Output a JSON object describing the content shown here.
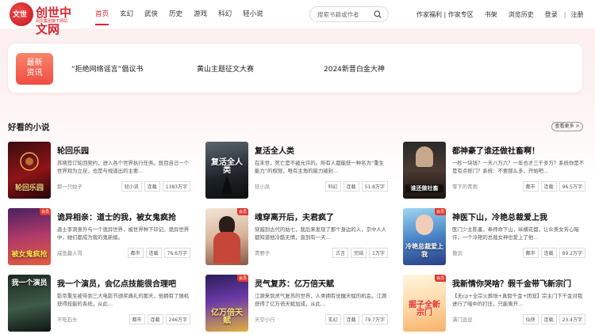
{
  "logo": {
    "badge": "文世",
    "name": "创世中文网",
    "sub": "阅文集团旗下网站"
  },
  "nav": [
    "首页",
    "玄幻",
    "武侠",
    "历史",
    "游戏",
    "科幻",
    "轻小说"
  ],
  "search": {
    "placeholder": "搜索书籍或作者"
  },
  "toplinks": {
    "author": "作家福利 | 作家专区",
    "shelf": "书架",
    "history": "浏览历史",
    "login": "登录",
    "sep": "|",
    "register": "注册"
  },
  "notice": {
    "badge_line1": "最新",
    "badge_line2": "资讯",
    "items": [
      "“拒绝网络谣言”倡议书",
      "黄山主题征文大赛",
      "2024新晋白金大神"
    ]
  },
  "section": {
    "title": "好看的小说",
    "more": "查看更多 >"
  },
  "books": [
    {
      "title": "轮回乐园",
      "desc": "苏晓签订轮回契约，进入各个世界执行任务。既目自己一个世界观为立足，也是与规道出的主要...",
      "author": "那一只蚊子",
      "tags": [
        "轻小说",
        "连载",
        "1383万字"
      ],
      "cover_text": "轮回乐园",
      "badge": ""
    },
    {
      "title": "复活全人类",
      "desc": "在末世，死亡是不被允许的。所有人都能获一种名为“重生能力”的权限，唯有主角的能力被封...",
      "author": "狂小风",
      "tags": [
        "科幻",
        "连载",
        "51.8万字"
      ],
      "cover_text": "复活全人类",
      "badge": ""
    },
    {
      "title": "都神豪了谁还做社畜啊！",
      "desc": "一秒一块钱？一天八万六？一年也才三千多万？系统你是不是有点抠门？系统：不要那么多，开始吧...",
      "author": "零下的青雨",
      "tags": [
        "都市",
        "连载",
        "96.5万字"
      ],
      "cover_text": "谁还做社畜",
      "badge": ""
    },
    {
      "title": "诡异相亲：道士的我，被女鬼疯抢",
      "desc": "道士李洞意外与一个诡异世界，被世界种下印记。诡异世界中，她们都成为我的鬼新娘。",
      "author": "咸鱼趣人哥",
      "tags": [
        "都市",
        "连载",
        "76.6万字"
      ],
      "cover_text": "被女鬼疯抢",
      "badge": "会员"
    },
    {
      "title": "魂穿离开后，夫君疯了",
      "desc": "穿越到古代的姑七，我后来发现了那个身边的人，京中人人都知道他冷酷无情，直到有一天...",
      "author": "青野子",
      "tags": [
        "古言",
        "完结",
        "1万字"
      ],
      "cover_text": "",
      "badge": "会员"
    },
    {
      "title": "神医下山，冷艳总裁爱上我",
      "desc": "医门少主陈墨，奉师命下山，纵横花都，让众美女芳心暗许，一个冷艳的总裁女神也爱上了他...",
      "author": "傲剑",
      "tags": [
        "都市",
        "连载",
        "89.2万字"
      ],
      "cover_text": "冷艳总裁爱上我",
      "badge": "会员"
    },
    {
      "title": "我一个演员，会亿点技能很合理吧",
      "desc": "影帝重生被带到三大电影节颁奖典礼的那天，他拥有了随机获得技能的系统，从此...",
      "author": "不吃石头",
      "tags": [
        "都市",
        "连载",
        "246万字"
      ],
      "cover_text": "我一个演员",
      "badge": ""
    },
    {
      "title": "灵气复苏：亿万倍天赋",
      "desc": "江源来到灵气复苏的世界，人类拥有觉醒天赋的机会。江源获得了亿万倍天赋加成，从此...",
      "author": "天空小行",
      "tags": [
        "玄幻",
        "连载",
        "79.7万字"
      ],
      "cover_text": "亿万倍天赋",
      "badge": "会员"
    },
    {
      "title": "我新情你哭啥？假千金带飞新宗门",
      "desc": "【无cp+全宗火葬场+真假千金+团宠】宗主门下千金对我进行了暗中的打压，只能离开...",
      "author": "满门逗逗",
      "tags": [
        "仙侠",
        "连载",
        "23.4万字"
      ],
      "cover_text": "掘子全新宗门",
      "badge": "会员"
    }
  ]
}
